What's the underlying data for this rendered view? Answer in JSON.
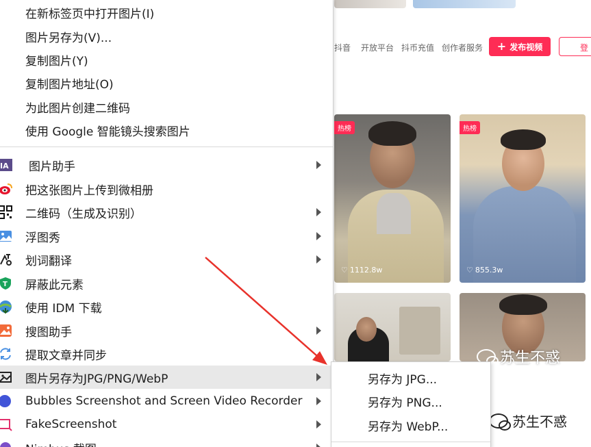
{
  "menu": {
    "items_top": [
      {
        "label": "在新标签页中打开图片(I)"
      },
      {
        "label": "图片另存为(V)..."
      },
      {
        "label": "复制图片(Y)"
      },
      {
        "label": "复制图片地址(O)"
      },
      {
        "label": "为此图片创建二维码"
      },
      {
        "label": "使用 Google 智能镜头搜索图片"
      }
    ],
    "items_ext": [
      {
        "label": "图片助手",
        "icon": "image-assistant-icon",
        "has_submenu": true
      },
      {
        "label": "把这张图片上传到微相册",
        "icon": "weibo-icon",
        "has_submenu": false
      },
      {
        "label": "二维码（生成及识别）",
        "icon": "qrcode-icon",
        "has_submenu": true
      },
      {
        "label": "浮图秀",
        "icon": "image-preview-icon",
        "has_submenu": true
      },
      {
        "label": "划词翻译",
        "icon": "translate-icon",
        "has_submenu": true
      },
      {
        "label": "屏蔽此元素",
        "icon": "block-element-icon",
        "has_submenu": false
      },
      {
        "label": "使用 IDM 下载",
        "icon": "idm-download-icon",
        "has_submenu": false
      },
      {
        "label": "搜图助手",
        "icon": "image-search-icon",
        "has_submenu": true
      },
      {
        "label": "提取文章并同步",
        "icon": "sync-icon",
        "has_submenu": false
      },
      {
        "label": "图片另存为JPG/PNG/WebP",
        "icon": "save-image-format-icon",
        "has_submenu": true
      },
      {
        "label": "Bubbles Screenshot and Screen Video Recorder",
        "icon": "bubbles-icon",
        "has_submenu": true
      },
      {
        "label": "FakeScreenshot",
        "icon": "fakescreenshot-icon",
        "has_submenu": true
      },
      {
        "label": "Nimbus 截图",
        "icon": "nimbus-icon",
        "has_submenu": true
      }
    ]
  },
  "submenu": {
    "items": [
      {
        "label": "另存为 JPG..."
      },
      {
        "label": "另存为 PNG..."
      },
      {
        "label": "另存为 WebP..."
      }
    ]
  },
  "page": {
    "nav": [
      "抖音",
      "开放平台",
      "抖币充值",
      "创作者服务"
    ],
    "publish_label": "发布视频",
    "login_label": "登",
    "cards": [
      {
        "badge": "热榜",
        "likes": "1112.8w"
      },
      {
        "badge": "热榜",
        "likes": "855.3w"
      }
    ],
    "watermark": "苏生不惑"
  },
  "colors": {
    "accent": "#fe2c55",
    "menu_highlight": "#e8e8e8",
    "annotation_arrow": "#e8322b"
  }
}
